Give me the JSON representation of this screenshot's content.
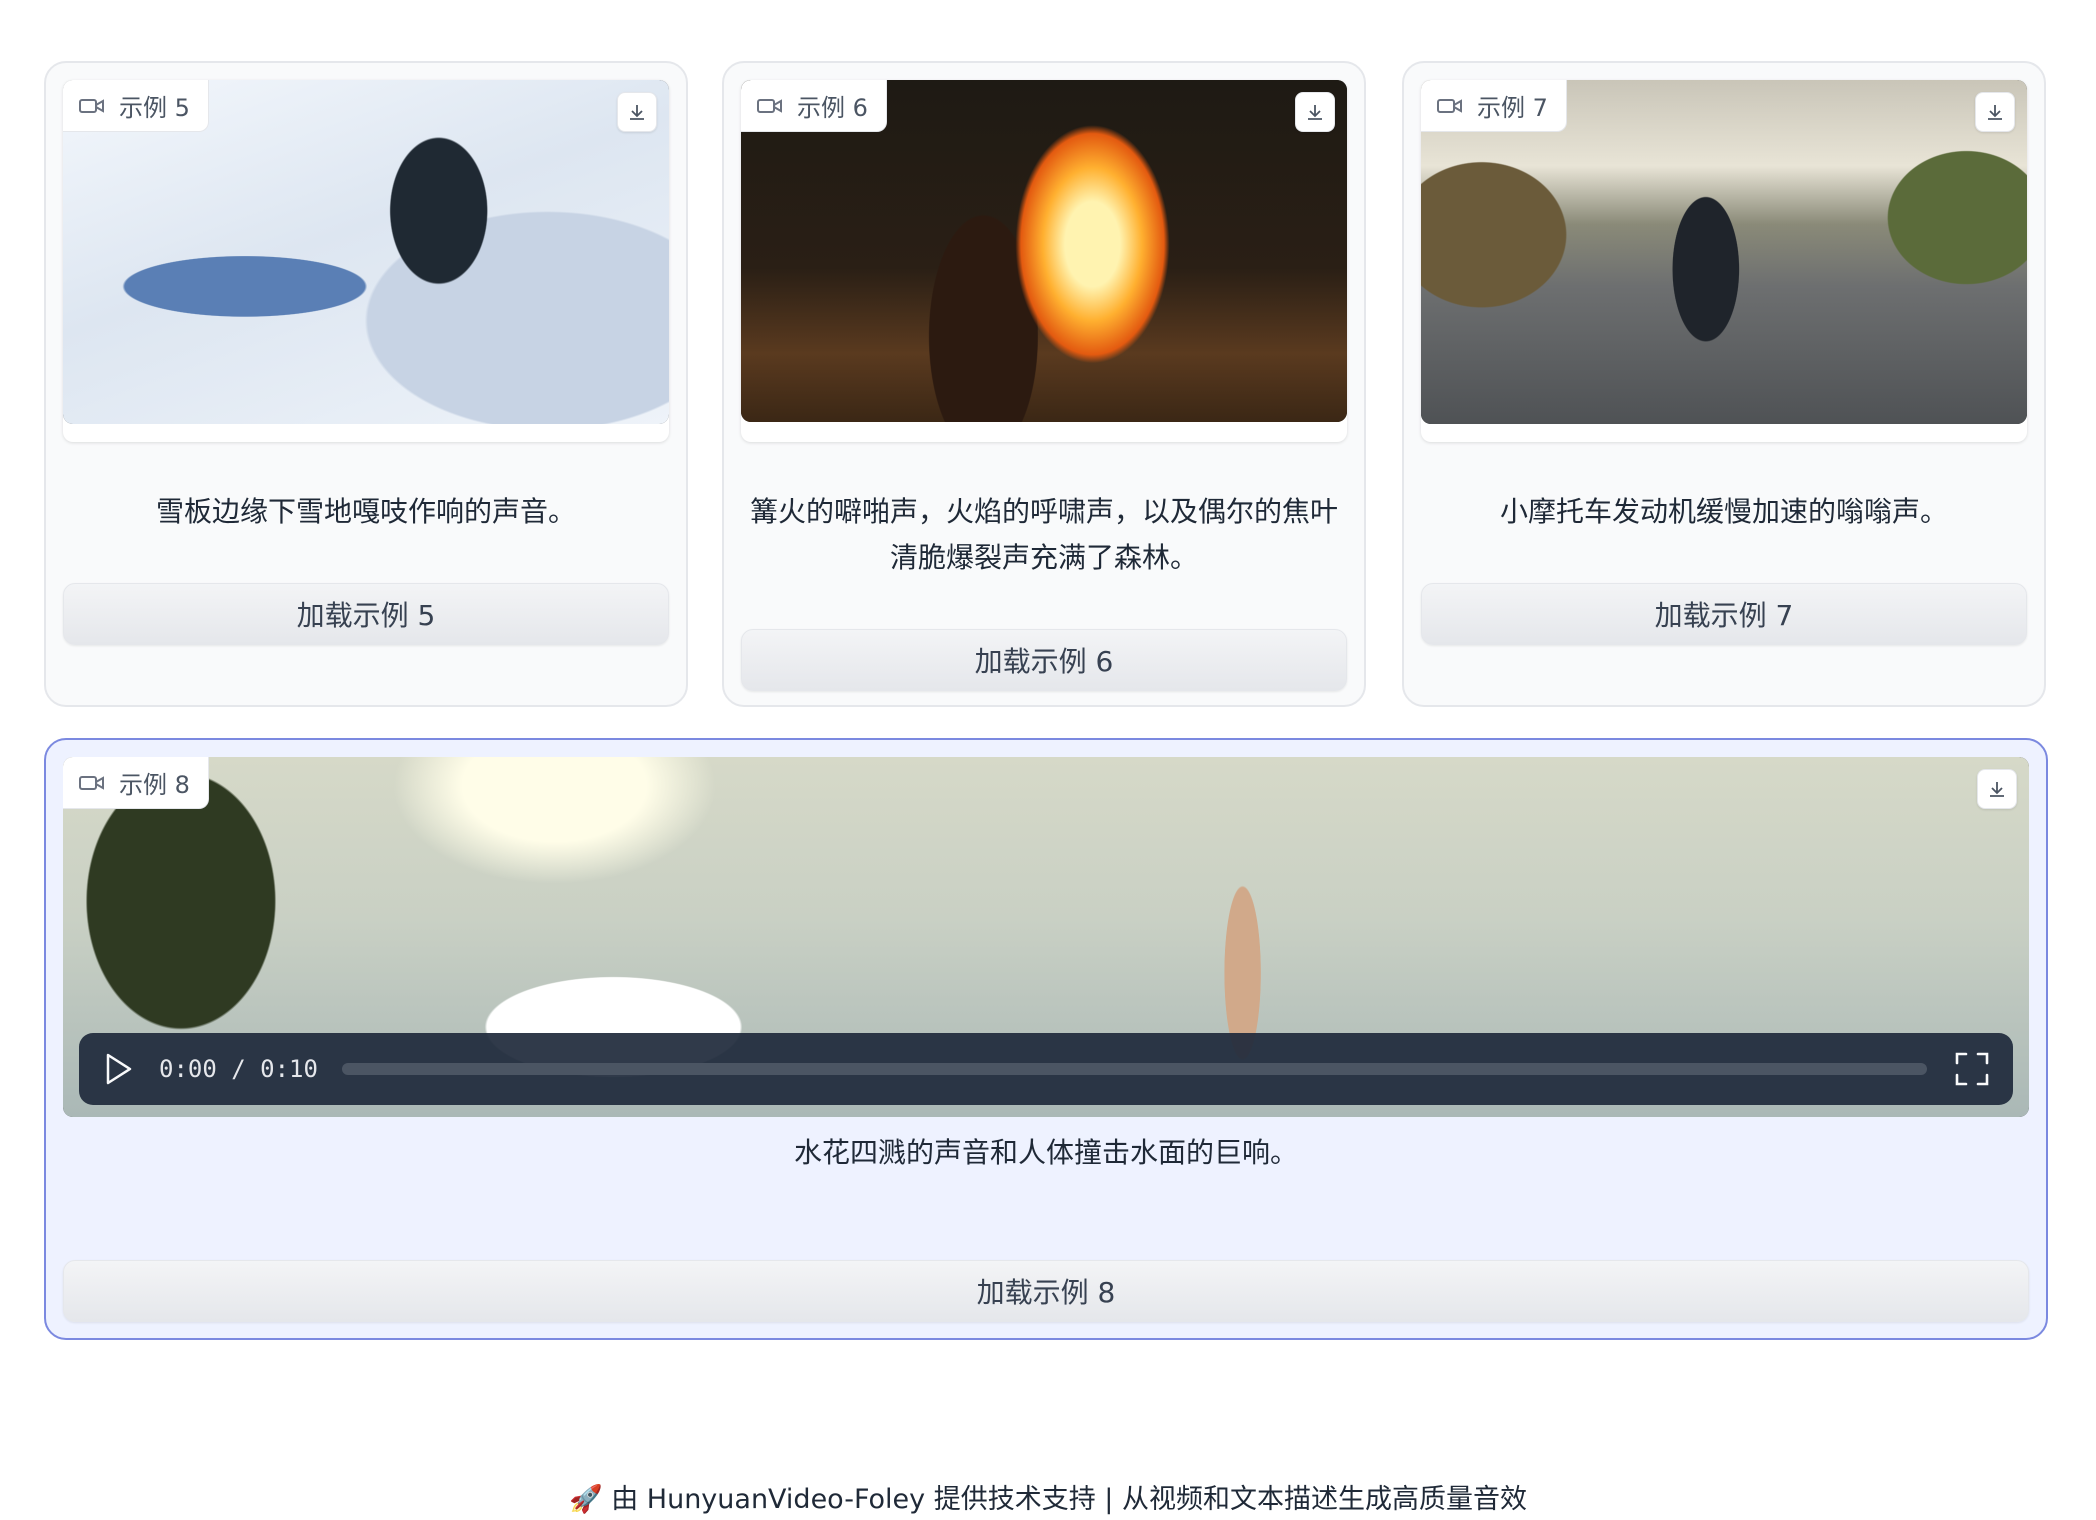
{
  "examples": [
    {
      "tag": "示例 5",
      "caption": "雪板边缘下雪地嘎吱作响的声音。",
      "button": "加载示例 5"
    },
    {
      "tag": "示例 6",
      "caption": "篝火的噼啪声，火焰的呼啸声，以及偶尔的焦叶清脆爆裂声充满了森林。",
      "button": "加载示例 6"
    },
    {
      "tag": "示例 7",
      "caption": "小摩托车发动机缓慢加速的嗡嗡声。",
      "button": "加载示例 7"
    },
    {
      "tag": "示例 8",
      "caption": "水花四溅的声音和人体撞击水面的巨响。",
      "button": "加载示例 8",
      "player": {
        "time": "0:00 / 0:10",
        "progress": 0
      }
    }
  ],
  "footer": "🚀 由 HunyuanVideo-Foley 提供技术支持 | 从视频和文本描述生成高质量音效",
  "colors": {
    "selected_border": "#7b89e0",
    "selected_bg": "#eef2ff"
  },
  "icons": {
    "tag": "video-camera-icon",
    "download": "download-icon",
    "play": "play-icon",
    "fullscreen": "fullscreen-icon"
  }
}
